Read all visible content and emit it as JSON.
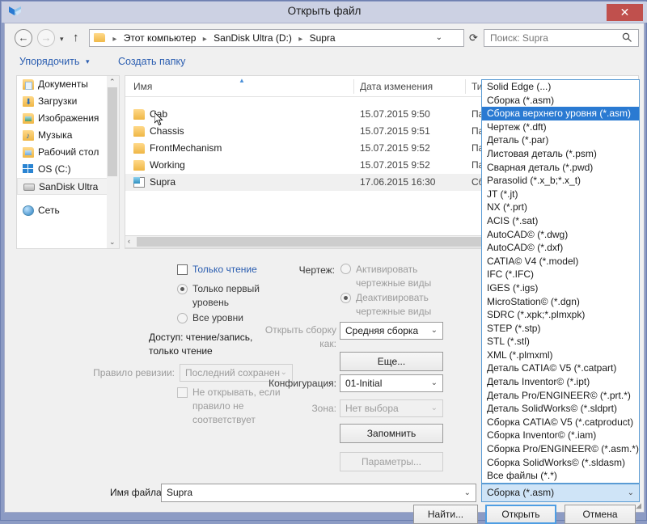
{
  "window": {
    "title": "Открыть файл",
    "close_label": "✕",
    "app_icon": "solid-edge-icon",
    "frame_color": "#8c9bc4",
    "titlebar_color": "#ccd1e3",
    "close_color": "#c0504d"
  },
  "address": {
    "back_icon": "←",
    "forward_icon": "→",
    "recent_icon": "▾",
    "up_icon": "↑",
    "dropdown_icon": "⌄",
    "refresh_icon": "⟳",
    "crumbs": [
      "Этот компьютер",
      "SanDisk Ultra (D:)",
      "Supra"
    ],
    "separator": "▸"
  },
  "search": {
    "placeholder": "Поиск: Supra",
    "icon": "search-icon"
  },
  "toolbar": {
    "organize_label": "Упорядочить",
    "organize_caret": "▾",
    "new_folder_label": "Создать папку"
  },
  "navpane": {
    "items": [
      {
        "label": "Документы",
        "icon": "folder-documents-icon",
        "selected": false
      },
      {
        "label": "Загрузки",
        "icon": "folder-downloads-icon",
        "selected": false
      },
      {
        "label": "Изображения",
        "icon": "folder-pictures-icon",
        "selected": false
      },
      {
        "label": "Музыка",
        "icon": "folder-music-icon",
        "selected": false
      },
      {
        "label": "Рабочий стол",
        "icon": "folder-desktop-icon",
        "selected": false
      },
      {
        "label": "OS (C:)",
        "icon": "windows-drive-icon",
        "selected": false
      },
      {
        "label": "SanDisk Ultra",
        "icon": "removable-drive-icon",
        "selected": true
      },
      {
        "label": "Сеть",
        "icon": "network-icon",
        "selected": false
      }
    ],
    "scroll_up": "⌃",
    "scroll_down": "⌄"
  },
  "filelist": {
    "columns": [
      "Имя",
      "Дата изменения",
      "Тип"
    ],
    "sort_indicator": "▲",
    "rows": [
      {
        "name": "Cab",
        "date": "15.07.2015 9:50",
        "type": "Пап",
        "icon": "folder-icon",
        "selected": false
      },
      {
        "name": "Chassis",
        "date": "15.07.2015 9:51",
        "type": "Пап",
        "icon": "folder-icon",
        "selected": false
      },
      {
        "name": "FrontMechanism",
        "date": "15.07.2015 9:52",
        "type": "Пап",
        "icon": "folder-icon",
        "selected": false
      },
      {
        "name": "Working",
        "date": "15.07.2015 9:52",
        "type": "Пап",
        "icon": "folder-icon",
        "selected": false
      },
      {
        "name": "Supra",
        "date": "17.06.2015 16:30",
        "type": "Сбо",
        "icon": "assembly-file-icon",
        "selected": true
      }
    ],
    "hscroll_left": "‹",
    "hscroll_right": "›"
  },
  "options": {
    "readonly_label": "Только чтение",
    "level_first_label": "Только первый\nуровень",
    "level_first_line1": "Только первый",
    "level_first_line2": "уровень",
    "level_all_label": "Все уровни",
    "access_line1": "Доступ: чтение/запись,",
    "access_line2": "только чтение",
    "revision_rule_label": "Правило ревизии:",
    "revision_rule_value": "Последний сохранен",
    "dont_open_line1": "Не открывать, если",
    "dont_open_line2": "правило не",
    "dont_open_line3": "соответствует",
    "drawing_label": "Чертеж:",
    "activate_line1": "Активировать",
    "activate_line2": "чертежные виды",
    "deactivate_line1": "Деактивировать",
    "deactivate_line2": "чертежные виды",
    "open_assembly_line1": "Открыть сборку",
    "open_assembly_line2": "как:",
    "open_assembly_value": "Средняя сборка",
    "more_button": "Еще...",
    "configuration_label": "Конфигурация:",
    "configuration_value": "01-Initial",
    "zone_label": "Зона:",
    "zone_value": "Нет выбора",
    "remember_button": "Запомнить",
    "parameters_button": "Параметры..."
  },
  "bottom": {
    "filename_label": "Имя файла:",
    "filename_value": "Supra",
    "filter_value": "Сборка (*.asm)",
    "caret": "⌄",
    "find_button": "Найти...",
    "open_button": "Открыть",
    "cancel_button": "Отмена"
  },
  "dropdown": {
    "highlighted_index": 2,
    "items": [
      "Solid Edge (...)",
      "Сборка (*.asm)",
      "Сборка верхнего уровня (*.asm)",
      "Чертеж (*.dft)",
      "Деталь (*.par)",
      "Листовая деталь (*.psm)",
      "Сварная деталь (*.pwd)",
      "Parasolid (*.x_b;*.x_t)",
      "JT (*.jt)",
      "NX (*.prt)",
      "ACIS (*.sat)",
      "AutoCAD© (*.dwg)",
      "AutoCAD© (*.dxf)",
      "CATIA© V4 (*.model)",
      "IFC (*.IFC)",
      "IGES (*.igs)",
      "MicroStation© (*.dgn)",
      "SDRC (*.xpk;*.plmxpk)",
      "STEP (*.stp)",
      "STL (*.stl)",
      "XML (*.plmxml)",
      "Деталь CATIA© V5 (*.catpart)",
      "Деталь Inventor© (*.ipt)",
      "Деталь Pro/ENGINEER© (*.prt.*)",
      "Деталь SolidWorks© (*.sldprt)",
      "Сборка CATIA© V5 (*.catproduct)",
      "Сборка Inventor© (*.iam)",
      "Сборка Pro/ENGINEER© (*.asm.*)",
      "Сборка SolidWorks© (*.sldasm)",
      "Все файлы (*.*)"
    ],
    "highlight_color": "#2a7ad2"
  }
}
